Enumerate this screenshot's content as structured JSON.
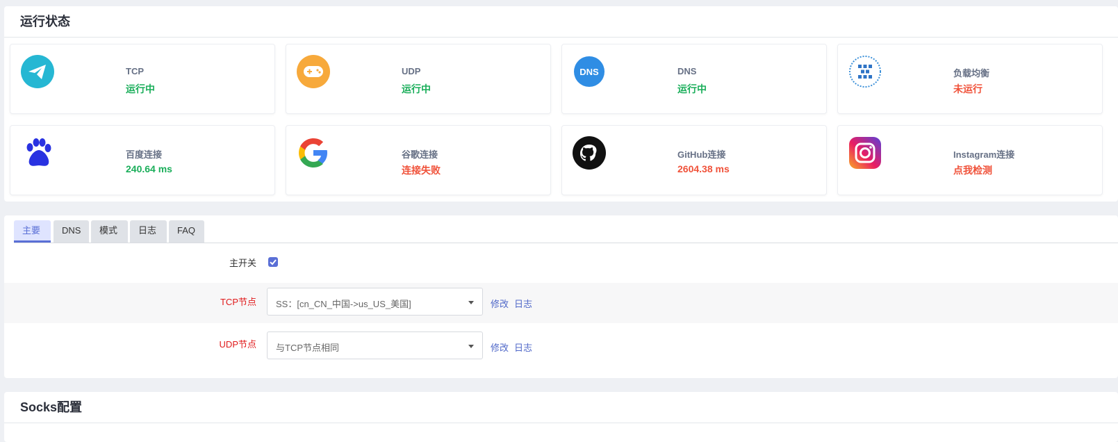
{
  "status": {
    "title": "运行状态",
    "cards": [
      {
        "name": "TCP",
        "value": "运行中",
        "icon": "paper-plane-icon"
      },
      {
        "name": "UDP",
        "value": "运行中",
        "icon": "gamepad-icon"
      },
      {
        "name": "DNS",
        "value": "运行中",
        "icon": "dns-icon",
        "icon_text": "DNS"
      },
      {
        "name": "负载均衡",
        "value": "未运行",
        "icon": "load-balance-icon"
      },
      {
        "name": "百度连接",
        "value": "240.64 ms",
        "icon": "baidu-paw-icon"
      },
      {
        "name": "谷歌连接",
        "value": "连接失败",
        "icon": "google-icon"
      },
      {
        "name": "GitHub连接",
        "value": "2604.38 ms",
        "icon": "github-icon"
      },
      {
        "name": "Instagram连接",
        "value": "点我检测",
        "icon": "instagram-icon"
      }
    ]
  },
  "tabs": [
    "主要",
    "DNS",
    "模式",
    "日志",
    "FAQ"
  ],
  "main": {
    "master_switch_label": "主开关",
    "master_switch_checked": true,
    "tcp_node_label": "TCP节点",
    "tcp_node_value": "SS：[cn_CN_中国->us_US_美国]",
    "udp_node_label": "UDP节点",
    "udp_node_value": "与TCP节点相同",
    "edit_label": "修改",
    "log_label": "日志"
  },
  "socks": {
    "title": "Socks配置"
  },
  "colors": {
    "ok": "#1aae5a",
    "error": "#f0523a",
    "accent": "#5a6fd6"
  }
}
